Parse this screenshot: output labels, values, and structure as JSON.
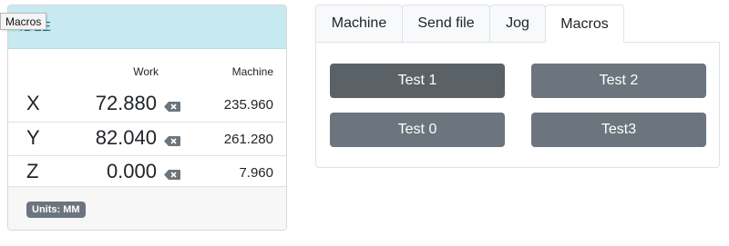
{
  "dro": {
    "state": "IDLE",
    "col_work": "Work",
    "col_machine": "Machine",
    "axes": [
      {
        "label": "X",
        "work": "72.880",
        "machine": "235.960"
      },
      {
        "label": "Y",
        "work": "82.040",
        "machine": "261.280"
      },
      {
        "label": "Z",
        "work": "0.000",
        "machine": "7.960"
      }
    ],
    "units": "Units: MM",
    "header_color": "#c6eaf0"
  },
  "tooltip": "Macros",
  "tabs": [
    {
      "label": "Machine",
      "active": false
    },
    {
      "label": "Send file",
      "active": false
    },
    {
      "label": "Jog",
      "active": false
    },
    {
      "label": "Macros",
      "active": true
    }
  ],
  "macros": [
    {
      "label": "Test 1"
    },
    {
      "label": "Test 2"
    },
    {
      "label": "Test 0"
    },
    {
      "label": "Test3"
    }
  ],
  "colors": {
    "button": "#6c757d",
    "button_hover": "#5a6268"
  },
  "icons": {
    "zero_axis": "backspace-icon"
  }
}
